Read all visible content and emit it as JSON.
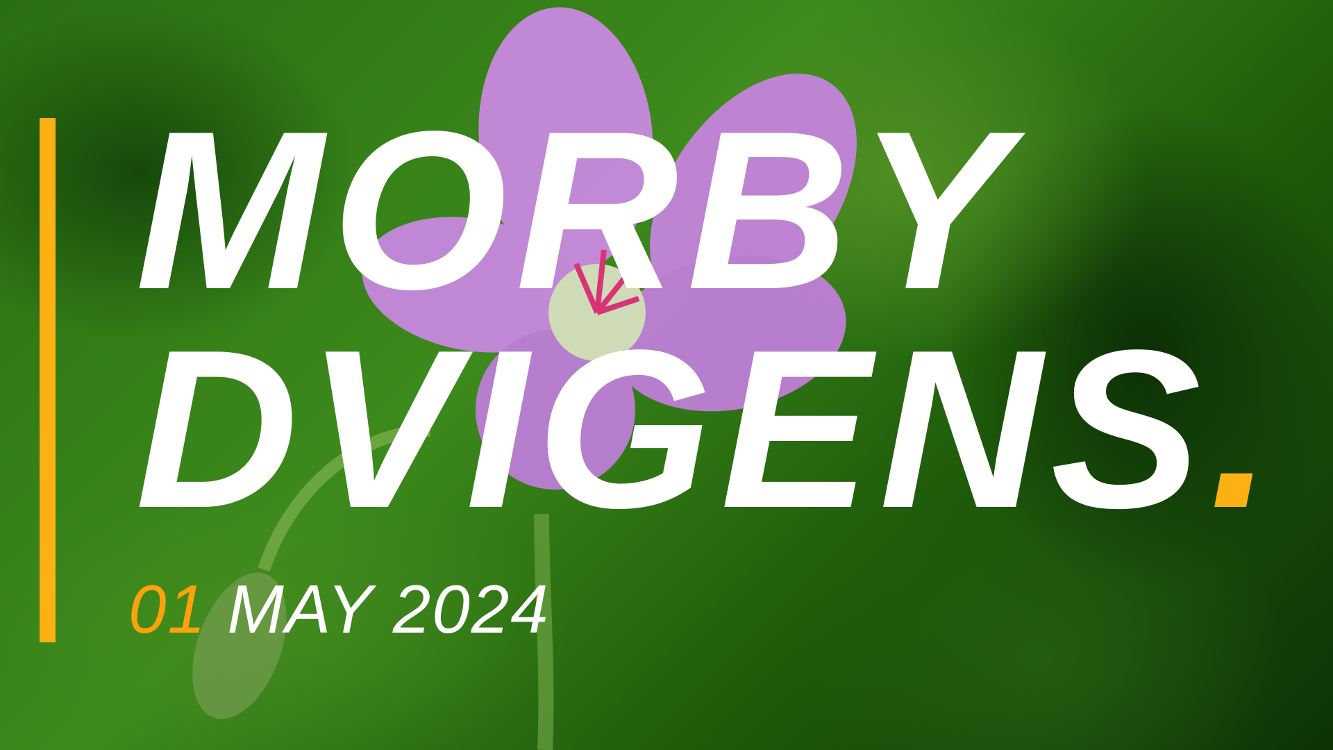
{
  "title": {
    "line1": "MORBY",
    "line2": "DVIGENS",
    "period": "."
  },
  "date": {
    "day": "01",
    "month_year": "MAY 2024"
  },
  "colors": {
    "accent": "#fcb014",
    "text": "#ffffff",
    "background": "#2a6e12"
  }
}
